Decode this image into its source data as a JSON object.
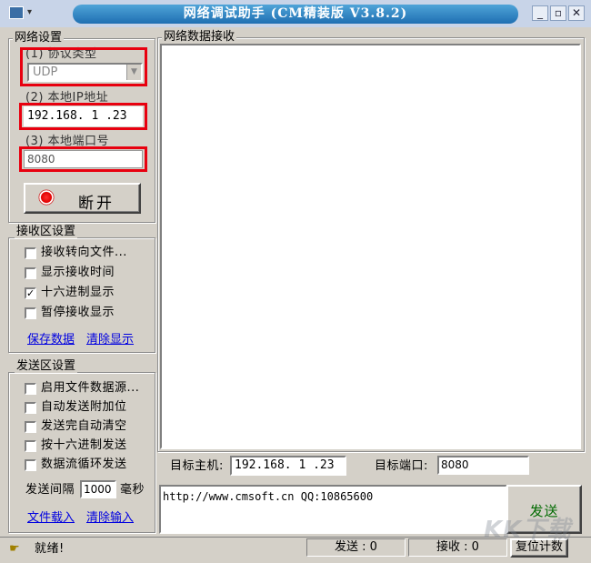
{
  "window": {
    "title": "网络调试助手 (CM精装版 V3.8.2)",
    "minimize": "_",
    "restore": "▫",
    "close": "✕"
  },
  "network": {
    "group_title": "网络设置",
    "protocol_label": "(1) 协议类型",
    "protocol_value": "UDP",
    "ip_label": "(2) 本地IP地址",
    "ip_value": "192.168. 1 .23",
    "port_label": "(3) 本地端口号",
    "port_value": "8080",
    "connect_button": "断开"
  },
  "receive_settings": {
    "group_title": "接收区设置",
    "options": [
      {
        "label": "接收转向文件...",
        "checked": false
      },
      {
        "label": "显示接收时间",
        "checked": false
      },
      {
        "label": "十六进制显示",
        "checked": true
      },
      {
        "label": "暂停接收显示",
        "checked": false
      }
    ],
    "save_link": "保存数据",
    "clear_link": "清除显示"
  },
  "send_settings": {
    "group_title": "发送区设置",
    "options": [
      {
        "label": "启用文件数据源...",
        "checked": false
      },
      {
        "label": "自动发送附加位",
        "checked": false
      },
      {
        "label": "发送完自动清空",
        "checked": false
      },
      {
        "label": "按十六进制发送",
        "checked": false
      },
      {
        "label": "数据流循环发送",
        "checked": false
      }
    ],
    "interval_label": "发送间隔",
    "interval_value": "1000",
    "interval_unit": "毫秒",
    "load_link": "文件载入",
    "clear_input_link": "清除输入"
  },
  "receive_area": {
    "title": "网络数据接收",
    "content": ""
  },
  "target": {
    "host_label": "目标主机:",
    "host_value": "192.168. 1 .23",
    "port_label": "目标端口:",
    "port_value": "8080"
  },
  "send_area": {
    "content": "http://www.cmsoft.cn QQ:10865600",
    "send_button": "发送"
  },
  "status": {
    "text": "就绪!",
    "sent": "发送 : 0",
    "received": "接收 : 0",
    "reset_button": "复位计数"
  },
  "watermark": "KK下载"
}
